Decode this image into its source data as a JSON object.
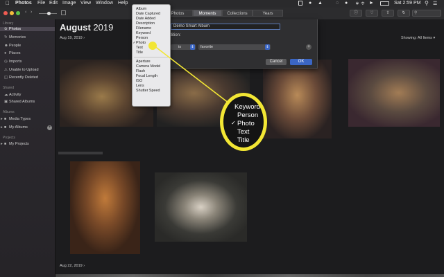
{
  "menubar": {
    "app": "Photos",
    "items": [
      "File",
      "Edit",
      "Image",
      "View",
      "Window",
      "Help"
    ],
    "clock": "Sat 2:59 PM"
  },
  "toolbar": {
    "tabs": [
      "Photos",
      "Moments",
      "Collections",
      "Years"
    ],
    "selected_tab": "Moments"
  },
  "sidebar": {
    "sections": [
      {
        "header": "Library",
        "items": [
          {
            "label": "Photos",
            "icon": "photos-icon",
            "selected": true
          },
          {
            "label": "Memories",
            "icon": "memories-icon"
          },
          {
            "label": "People",
            "icon": "people-icon"
          },
          {
            "label": "Places",
            "icon": "places-icon"
          },
          {
            "label": "Imports",
            "icon": "imports-icon"
          },
          {
            "label": "Unable to Upload",
            "icon": "warning-icon"
          },
          {
            "label": "Recently Deleted",
            "icon": "trash-icon"
          }
        ]
      },
      {
        "header": "Shared",
        "items": [
          {
            "label": "Activity",
            "icon": "activity-icon"
          },
          {
            "label": "Shared Albums",
            "icon": "shared-albums-icon"
          }
        ]
      },
      {
        "header": "Albums",
        "items": [
          {
            "label": "Media Types",
            "icon": "folder-icon"
          },
          {
            "label": "My Albums",
            "icon": "folder-icon"
          }
        ]
      },
      {
        "header": "Projects",
        "items": [
          {
            "label": "My Projects",
            "icon": "folder-icon"
          }
        ]
      }
    ]
  },
  "main": {
    "title_month": "August",
    "title_year": "2019",
    "date1": "Aug 19, 2019",
    "date2": "Aug 22, 2019",
    "showing": "Showing: All Items"
  },
  "dialog": {
    "name_value": "Demo Smart Album",
    "condition_label": "ondition:",
    "operator": "is",
    "value": "favorite",
    "cancel": "Cancel",
    "ok": "OK"
  },
  "menu": {
    "items": [
      "Album",
      "Date Captured",
      "Date Added",
      "Description",
      "Filename",
      "Keyword",
      "Person",
      "Photo",
      "Text",
      "Title"
    ],
    "items2": [
      "Aperture",
      "Camera Model",
      "Flash",
      "Focal Length",
      "ISO",
      "Lens",
      "Shutter Speed"
    ],
    "checked": "Photo"
  },
  "magnifier": {
    "items": [
      "Keyword",
      "Person",
      "Photo",
      "Text",
      "Title"
    ],
    "checked": "Photo"
  },
  "colors": {
    "callout": "#f2e634",
    "accent": "#3b66c4"
  }
}
